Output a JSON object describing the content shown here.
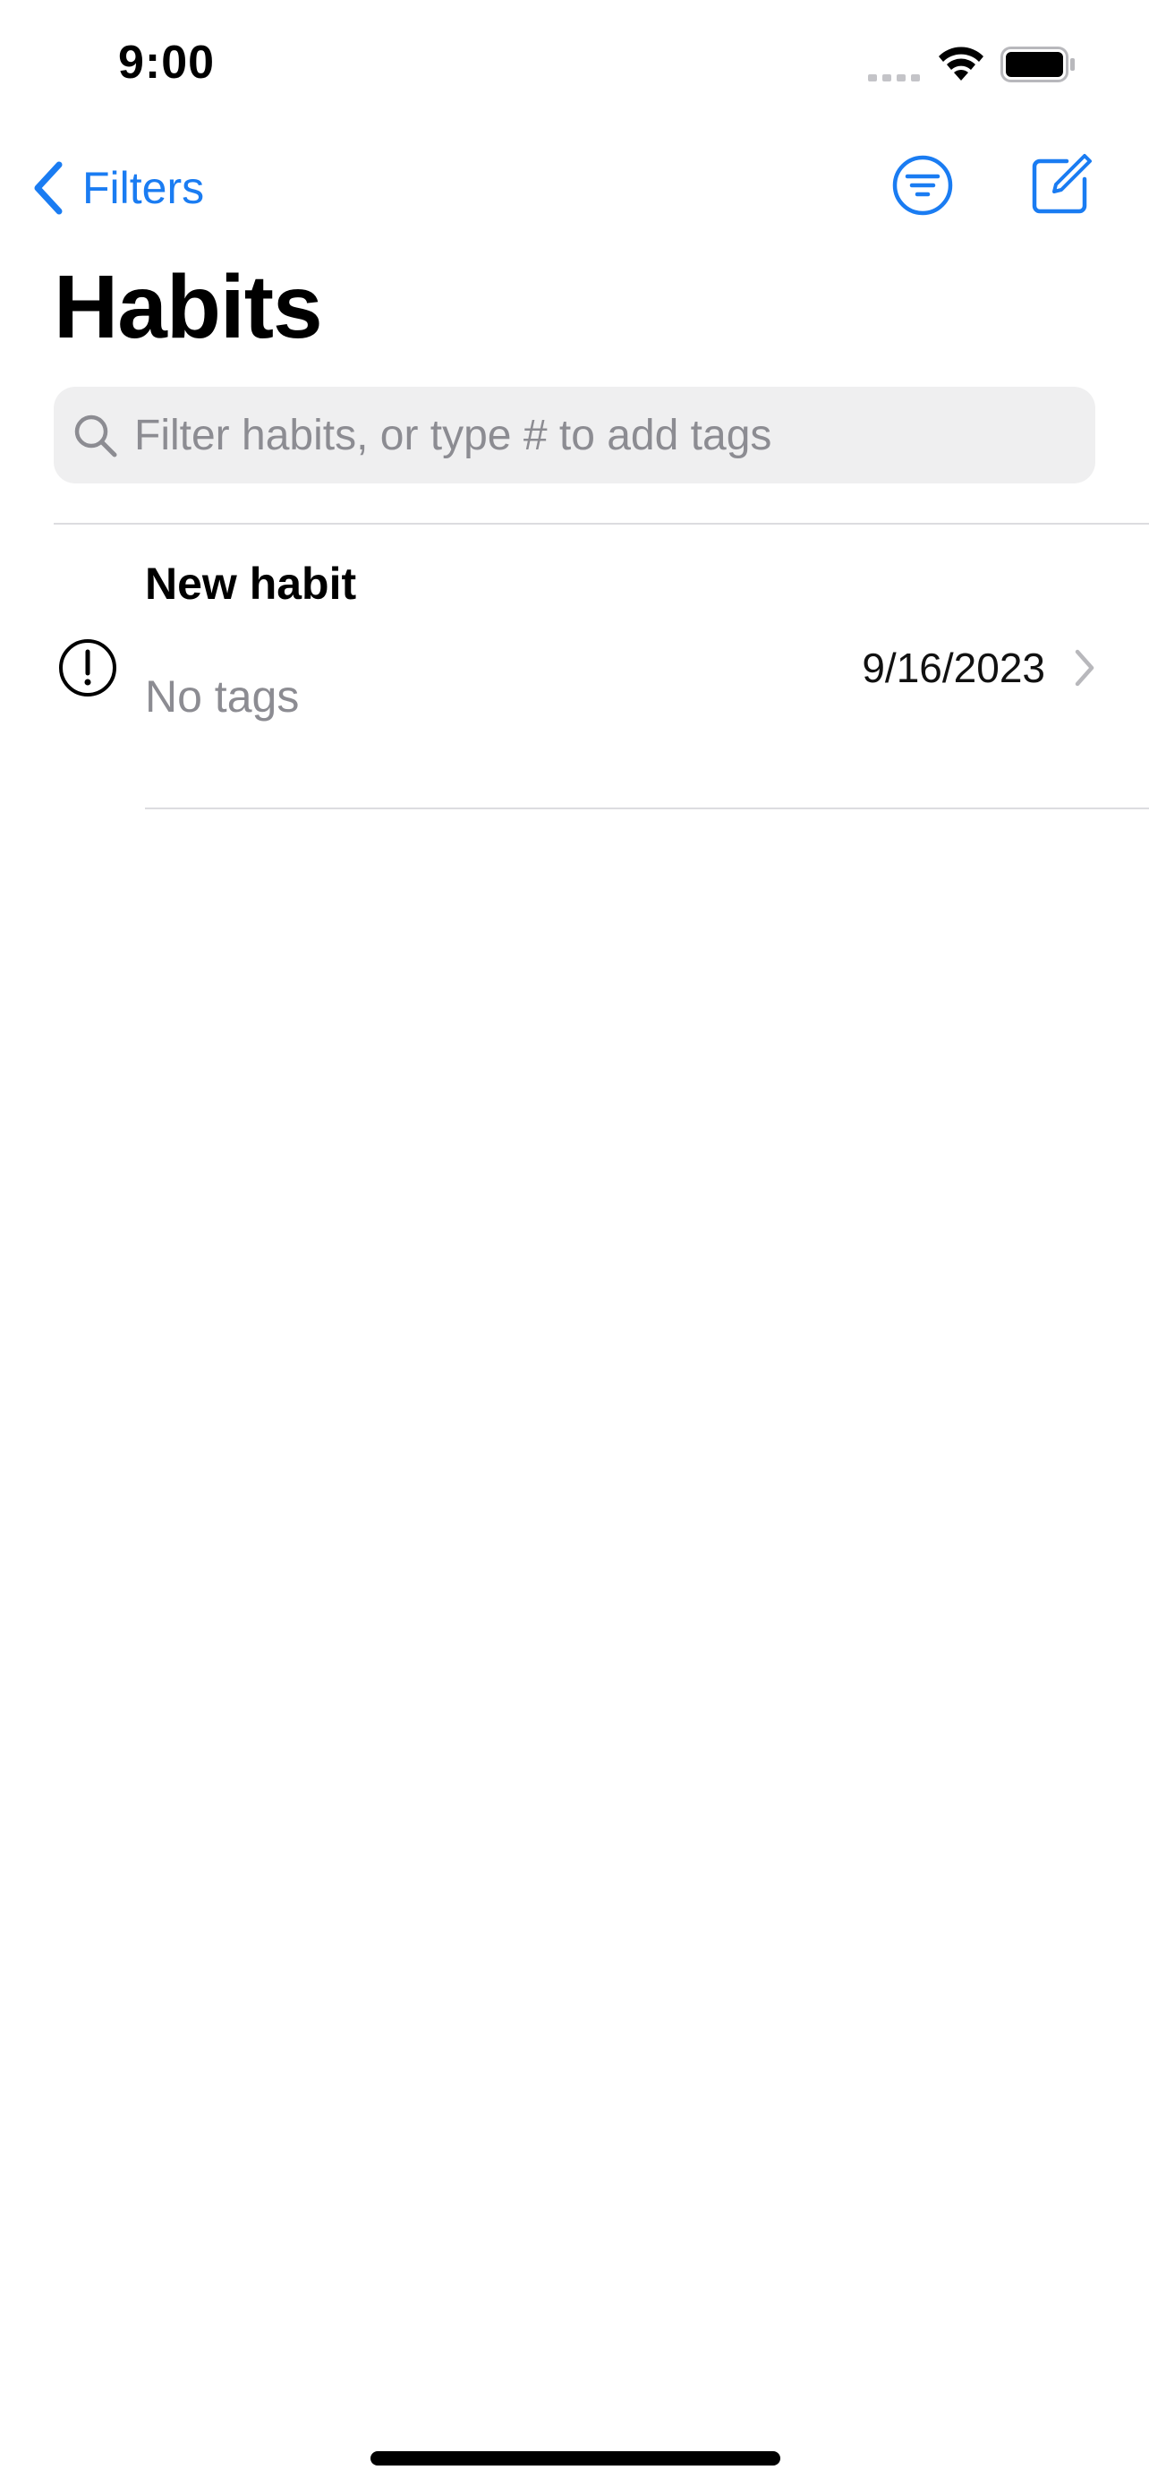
{
  "status_bar": {
    "time": "9:00"
  },
  "nav": {
    "back_label": "Filters"
  },
  "page": {
    "title": "Habits"
  },
  "search": {
    "placeholder": "Filter habits, or type # to add tags",
    "value": ""
  },
  "habits": [
    {
      "title": "New habit",
      "tags": "No tags",
      "date": "9/16/2023",
      "status_icon": "exclamation-circle-icon"
    }
  ],
  "colors": {
    "accent": "#1a7cf2",
    "secondary_text": "#8c8c92",
    "search_background": "#efeff0",
    "divider": "#dcdce0"
  },
  "icons": {
    "back": "chevron-left-icon",
    "filter": "filter-circle-icon",
    "compose": "compose-icon",
    "search": "search-icon",
    "row_disclosure": "chevron-right-icon"
  }
}
